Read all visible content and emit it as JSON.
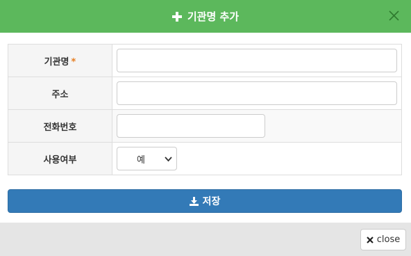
{
  "header": {
    "title": "기관명 추가",
    "plus_icon": "plus-icon",
    "close_icon": "close-icon",
    "color": "#5cb85c"
  },
  "form": {
    "rows": [
      {
        "label": "기관명",
        "required_mark": "*",
        "value": "",
        "type": "text"
      },
      {
        "label": "주소",
        "value": "",
        "type": "text"
      },
      {
        "label": "전화번호",
        "value": "",
        "type": "text"
      },
      {
        "label": "사용여부",
        "value": "예",
        "type": "select"
      }
    ]
  },
  "save_button": {
    "label": "저장",
    "icon": "download-icon",
    "color": "#337ab7"
  },
  "footer": {
    "close_label": "close",
    "icon": "times-icon"
  }
}
